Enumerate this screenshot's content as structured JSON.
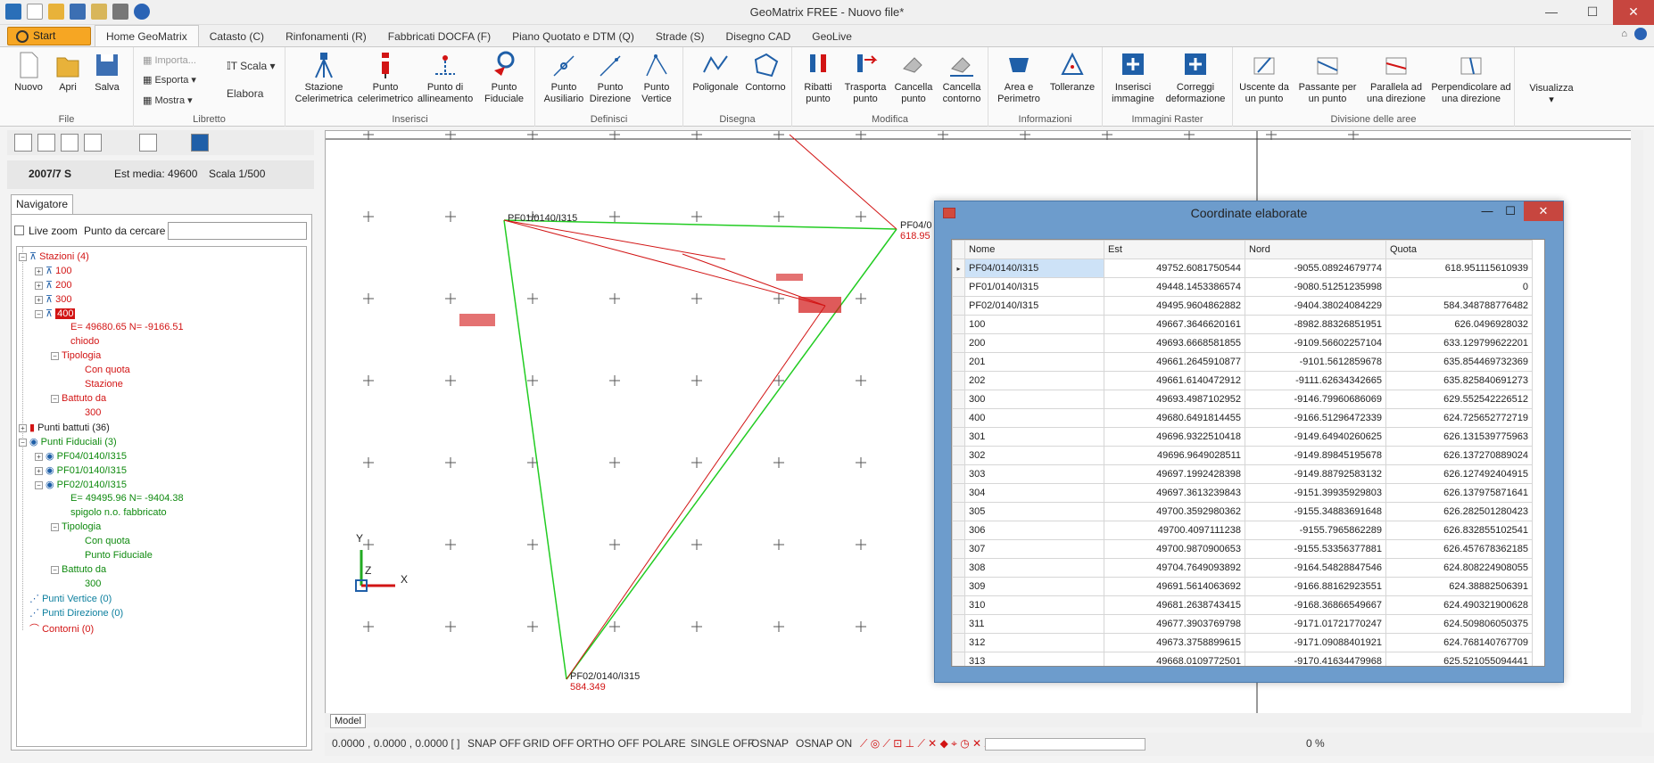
{
  "window": {
    "title": "GeoMatrix FREE - Nuovo file*",
    "controls": [
      "—",
      "☐",
      "✕"
    ]
  },
  "ribbon": {
    "start_label": "Start",
    "tabs": [
      "Home GeoMatrix",
      "Catasto (C)",
      "Rinfonamenti (R)",
      "Fabbricati DOCFA (F)",
      "Piano Quotato e DTM (Q)",
      "Strade (S)",
      "Disegno CAD",
      "GeoLive"
    ],
    "groups": {
      "file": {
        "label": "File",
        "nuovo": "Nuovo",
        "apri": "Apri",
        "salva": "Salva"
      },
      "libretto": {
        "label": "Libretto",
        "importa": "Importa...",
        "esporta": "Esporta",
        "mostra": "Mostra",
        "scala": "Scala",
        "elabora": "Elabora"
      },
      "inserisci": {
        "label": "Inserisci",
        "b1": "Stazione Celerimetrica",
        "b2": "Punto celerimetrico",
        "b3": "Punto di allineamento",
        "b4": "Punto Fiduciale"
      },
      "definisci": {
        "label": "Definisci",
        "b1": "Punto Ausiliario",
        "b2": "Punto Direzione",
        "b3": "Punto Vertice"
      },
      "disegna": {
        "label": "Disegna",
        "b1": "Poligonale",
        "b2": "Contorno"
      },
      "modifica": {
        "label": "Modifica",
        "b1": "Ribatti punto",
        "b2": "Trasporta punto",
        "b3": "Cancella punto",
        "b4": "Cancella contorno"
      },
      "informazioni": {
        "label": "Informazioni",
        "b1": "Area e Perimetro",
        "b2": "Tolleranze"
      },
      "immagini": {
        "label": "Immagini Raster",
        "b1": "Inserisci immagine",
        "b2": "Correggi deformazione"
      },
      "divisione": {
        "label": "Divisione delle aree",
        "b1": "Uscente da un punto",
        "b2": "Passante per un punto",
        "b3": "Parallela ad una direzione",
        "b4": "Perpendicolare ad una direzione"
      },
      "visualizza": {
        "label": "Visualizza"
      }
    }
  },
  "leftpanel": {
    "info": {
      "foglio": "2007/7 S",
      "est_media": "Est media: 49600",
      "scala": "Scala 1/500"
    },
    "nav_tab": "Navigatore",
    "live_zoom": "Live zoom",
    "search_label": "Punto da cercare",
    "search_value": "",
    "tree": {
      "stazioni": "Stazioni (4)",
      "s100": "100",
      "s200": "200",
      "s300": "300",
      "s400": "400",
      "s400_coords": "E= 49680.65 N= -9166.51",
      "s400_note": "chiodo",
      "tipologia": "Tipologia",
      "con_quota": "Con quota",
      "stazione": "Stazione",
      "battuto_da": "Battuto da",
      "b300": "300",
      "punti_battuti": "Punti battuti (36)",
      "punti_fiduciali": "Punti Fiduciali (3)",
      "pf04": "PF04/0140/I315",
      "pf01": "PF01/0140/I315",
      "pf02": "PF02/0140/I315",
      "pf02_coords": "E= 49495.96 N= -9404.38",
      "pf02_note": "spigolo n.o. fabbricato",
      "tipologia2": "Tipologia",
      "con_quota2": "Con quota",
      "punto_fiduciale": "Punto Fiduciale",
      "battuto_da2": "Battuto da",
      "b300b": "300",
      "punti_vertice": "Punti Vertice (0)",
      "punti_direzione": "Punti Direzione (0)",
      "contorni": "Contorni (0)"
    }
  },
  "canvas": {
    "labels": {
      "pf01": "PF01/0140/I315",
      "pf02": "PF02/0140/I315",
      "pf02_q": "584.349",
      "pf04": "PF04/0",
      "pf04_q": "618.95"
    },
    "axes": {
      "x": "X",
      "y": "Y",
      "z": "Z"
    },
    "model_tab": "Model"
  },
  "statusbar": {
    "coords": "0.0000 , 0.0000 , 0.0000 [ ]",
    "snap": "SNAP OFF",
    "grid": "GRID OFF",
    "ortho": "ORTHO OFF",
    "polare": "POLARE",
    "single": "SINGLE OFF",
    "osnap": "OSNAP",
    "osnap_on": "OSNAP ON",
    "zoom": "0 %"
  },
  "coord_window": {
    "title": "Coordinate elaborate",
    "columns": [
      "Nome",
      "Est",
      "Nord",
      "Quota"
    ],
    "rows": [
      [
        "PF04/0140/I315",
        "49752.6081750544",
        "-9055.08924679774",
        "618.951115610939"
      ],
      [
        "PF01/0140/I315",
        "49448.1453386574",
        "-9080.51251235998",
        "0"
      ],
      [
        "PF02/0140/I315",
        "49495.9604862882",
        "-9404.38024084229",
        "584.348788776482"
      ],
      [
        "100",
        "49667.3646620161",
        "-8982.88326851951",
        "626.0496928032"
      ],
      [
        "200",
        "49693.6668581855",
        "-9109.56602257104",
        "633.129799622201"
      ],
      [
        "201",
        "49661.2645910877",
        "-9101.5612859678",
        "635.854469732369"
      ],
      [
        "202",
        "49661.6140472912",
        "-9111.62634342665",
        "635.825840691273"
      ],
      [
        "300",
        "49693.4987102952",
        "-9146.79960686069",
        "629.552542226512"
      ],
      [
        "400",
        "49680.6491814455",
        "-9166.51296472339",
        "624.725652772719"
      ],
      [
        "301",
        "49696.9322510418",
        "-9149.64940260625",
        "626.131539775963"
      ],
      [
        "302",
        "49696.9649028511",
        "-9149.89845195678",
        "626.137270889024"
      ],
      [
        "303",
        "49697.1992428398",
        "-9149.88792583132",
        "626.127492404915"
      ],
      [
        "304",
        "49697.3613239843",
        "-9151.39935929803",
        "626.137975871641"
      ],
      [
        "305",
        "49700.3592980362",
        "-9155.34883691648",
        "626.282501280423"
      ],
      [
        "306",
        "49700.4097111238",
        "-9155.7965862289",
        "626.832855102541"
      ],
      [
        "307",
        "49700.9870900653",
        "-9155.53356377881",
        "626.457678362185"
      ],
      [
        "308",
        "49704.7649093892",
        "-9164.54828847546",
        "624.808224908055"
      ],
      [
        "309",
        "49691.5614063692",
        "-9166.88162923551",
        "624.38882506391"
      ],
      [
        "310",
        "49681.2638743415",
        "-9168.36866549667",
        "624.490321900628"
      ],
      [
        "311",
        "49677.3903769798",
        "-9171.01721770247",
        "624.509806050375"
      ],
      [
        "312",
        "49673.3758899615",
        "-9171.09088401921",
        "624.768140767709"
      ],
      [
        "313",
        "49668.0109772501",
        "-9170.41634479968",
        "625.521055094441"
      ]
    ]
  },
  "colors": {
    "station_red": "#d21414",
    "fiducial_green": "#0f8a0f",
    "accent_blue": "#1f5fa8",
    "start_orange": "#f6a623"
  }
}
